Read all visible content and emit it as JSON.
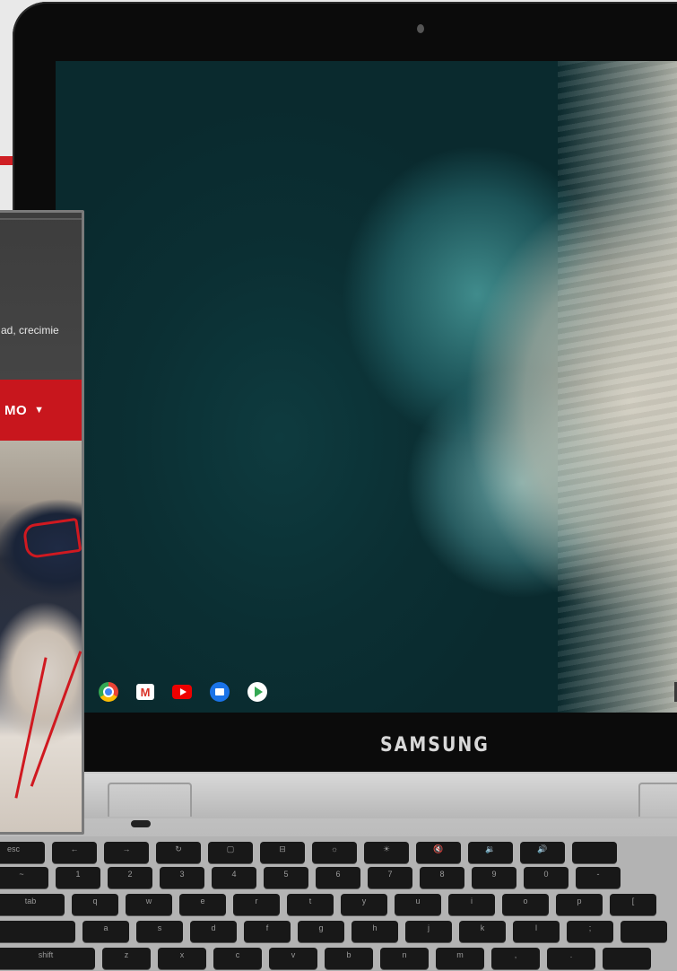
{
  "laptop": {
    "brand": "SAMSUNG",
    "shelf": [
      {
        "icon": "chrome-icon"
      },
      {
        "icon": "gmail-icon",
        "glyph": "M"
      },
      {
        "icon": "youtube-icon"
      },
      {
        "icon": "files-icon"
      },
      {
        "icon": "play-store-icon"
      }
    ],
    "pen_glyph": "✎",
    "keyboard": {
      "row1": [
        "esc",
        "←",
        "→",
        "↻",
        "▢",
        "⊟",
        "☼",
        "☀",
        "🔇",
        "🔉",
        "🔊",
        ""
      ],
      "row2": [
        "~",
        "1",
        "2",
        "3",
        "4",
        "5",
        "6",
        "7",
        "8",
        "9",
        "0",
        "-"
      ],
      "row3": [
        "tab",
        "q",
        "w",
        "e",
        "r",
        "t",
        "y",
        "u",
        "i",
        "o",
        "p",
        "["
      ],
      "row4": [
        "",
        "a",
        "s",
        "d",
        "f",
        "g",
        "h",
        "j",
        "k",
        "l",
        ";",
        ""
      ],
      "row5": [
        "shift",
        "z",
        "x",
        "c",
        "v",
        "b",
        "n",
        "m",
        ",",
        ".",
        ""
      ]
    }
  },
  "web_panel": {
    "description_fragment": "ad, crecimie",
    "nav_label": "MO",
    "nav_caret": "▼"
  },
  "colors": {
    "accent_red": "#cf1f24",
    "nav_red": "#c8161d",
    "bezel": "#0b0b0b",
    "body_silver": "#c0c0c0"
  }
}
